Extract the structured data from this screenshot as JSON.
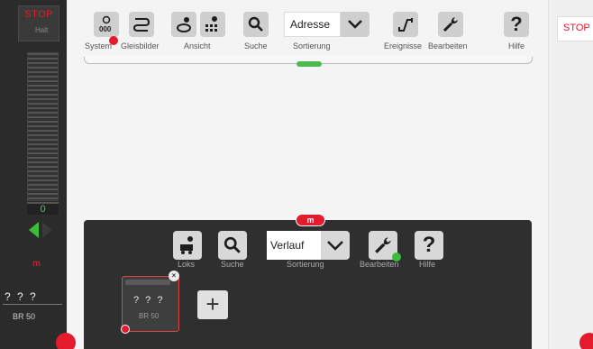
{
  "left_panel": {
    "stop_label": "STOP",
    "halt_label": "Halt",
    "speed_value": "0",
    "loco_address": "? ? ?",
    "loco_name": "BR 50",
    "m_label": "m"
  },
  "toolbar": {
    "system_label": "System",
    "track_diagrams_label": "Gleisbilder",
    "view_label": "Ansicht",
    "search_label": "Suche",
    "sort_value": "Adresse",
    "sort_label": "Sortierung",
    "events_label": "Ereignisse",
    "edit_label": "Bearbeiten",
    "help_label": "Hilfe",
    "stop_right_label": "STOP",
    "help_glyph": "?"
  },
  "loco_panel": {
    "m_badge": "m",
    "locos_label": "Loks",
    "search_label": "Suche",
    "sort_value": "Verlauf",
    "sort_label": "Sortierung",
    "edit_label": "Bearbeiten",
    "help_label": "Hilfe",
    "help_glyph": "?",
    "card": {
      "address": "? ? ?",
      "name": "BR 50"
    },
    "add_glyph": "+"
  },
  "colors": {
    "accent_red": "#e31b2d",
    "accent_green": "#3bbd3b",
    "panel_dark": "#2f2f2f"
  }
}
